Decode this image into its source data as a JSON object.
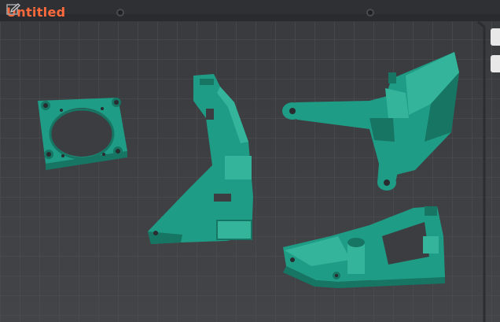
{
  "project": {
    "title": "Untitled",
    "edit_icon": "pencil-icon"
  },
  "colors": {
    "model": "#1f9c86",
    "model_dark": "#167563",
    "model_light": "#33b49b",
    "plate": "#3c3d40",
    "grid_line": "#4f5054",
    "title_accent": "#ff6a3d"
  },
  "icons": {
    "edit": "pencil-icon"
  }
}
